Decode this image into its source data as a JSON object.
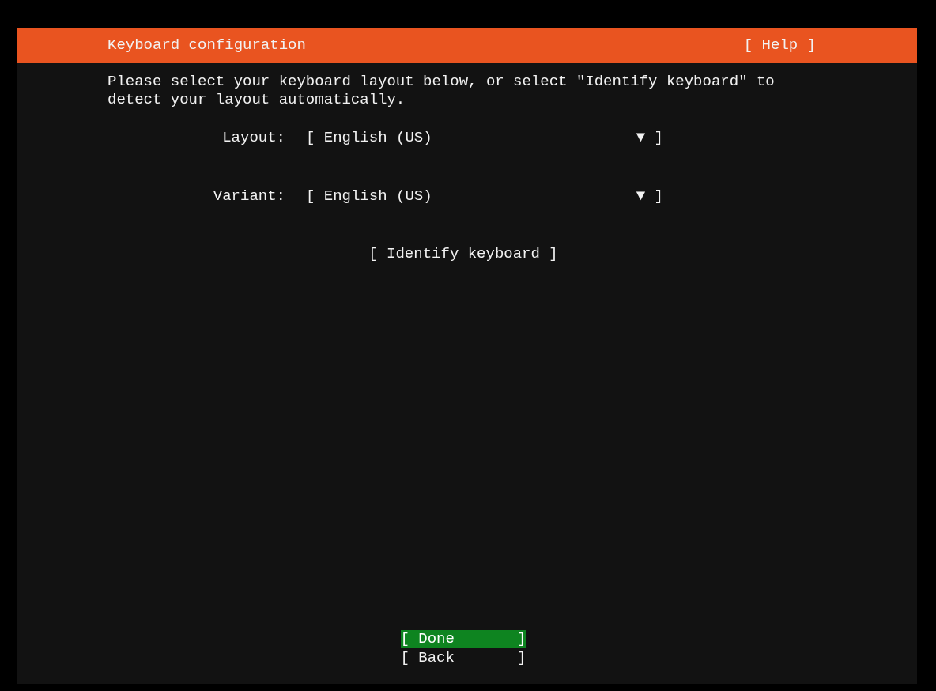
{
  "header": {
    "title": "Keyboard configuration",
    "help": "[ Help ]"
  },
  "intro": "Please select your keyboard layout below, or select \"Identify keyboard\" to detect your layout automatically.",
  "fields": [
    {
      "label": "Layout:",
      "open": "[",
      "value": "English (US)",
      "arrow": "▼",
      "close": "]"
    },
    {
      "label": "Variant:",
      "open": "[",
      "value": "English (US)",
      "arrow": "▼",
      "close": "]"
    }
  ],
  "identify_button": "[ Identify keyboard ]",
  "buttons": [
    {
      "open": "[",
      "label": "Done",
      "close": "]",
      "selected": true
    },
    {
      "open": "[",
      "label": "Back",
      "close": "]",
      "selected": false
    }
  ]
}
